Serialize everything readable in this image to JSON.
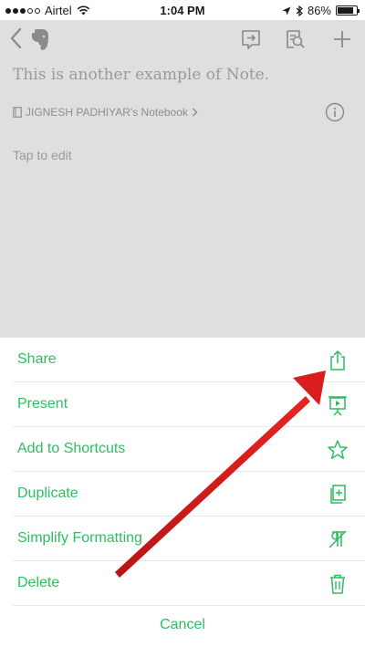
{
  "status_bar": {
    "carrier": "Airtel",
    "time": "1:04 PM",
    "battery": "86%",
    "battery_level": 0.86
  },
  "nav": {
    "icons": [
      "back-chevron-icon",
      "evernote-logo-icon",
      "present-screen-icon",
      "note-search-icon",
      "plus-icon"
    ]
  },
  "note": {
    "title": "This is another example of Note.",
    "notebook": "JIGNESH PADHIYAR's Notebook",
    "body_placeholder": "Tap to edit"
  },
  "action_sheet": {
    "accent_color": "#2dbe60",
    "items": [
      {
        "label": "Share",
        "icon": "share-icon"
      },
      {
        "label": "Present",
        "icon": "present-icon"
      },
      {
        "label": "Add to Shortcuts",
        "icon": "star-icon"
      },
      {
        "label": "Duplicate",
        "icon": "duplicate-icon"
      },
      {
        "label": "Simplify Formatting",
        "icon": "clear-formatting-icon"
      },
      {
        "label": "Delete",
        "icon": "trash-icon"
      }
    ],
    "cancel_label": "Cancel"
  },
  "annotation": {
    "arrow_color": "#d81e1e",
    "arrow_target": "share-icon"
  }
}
